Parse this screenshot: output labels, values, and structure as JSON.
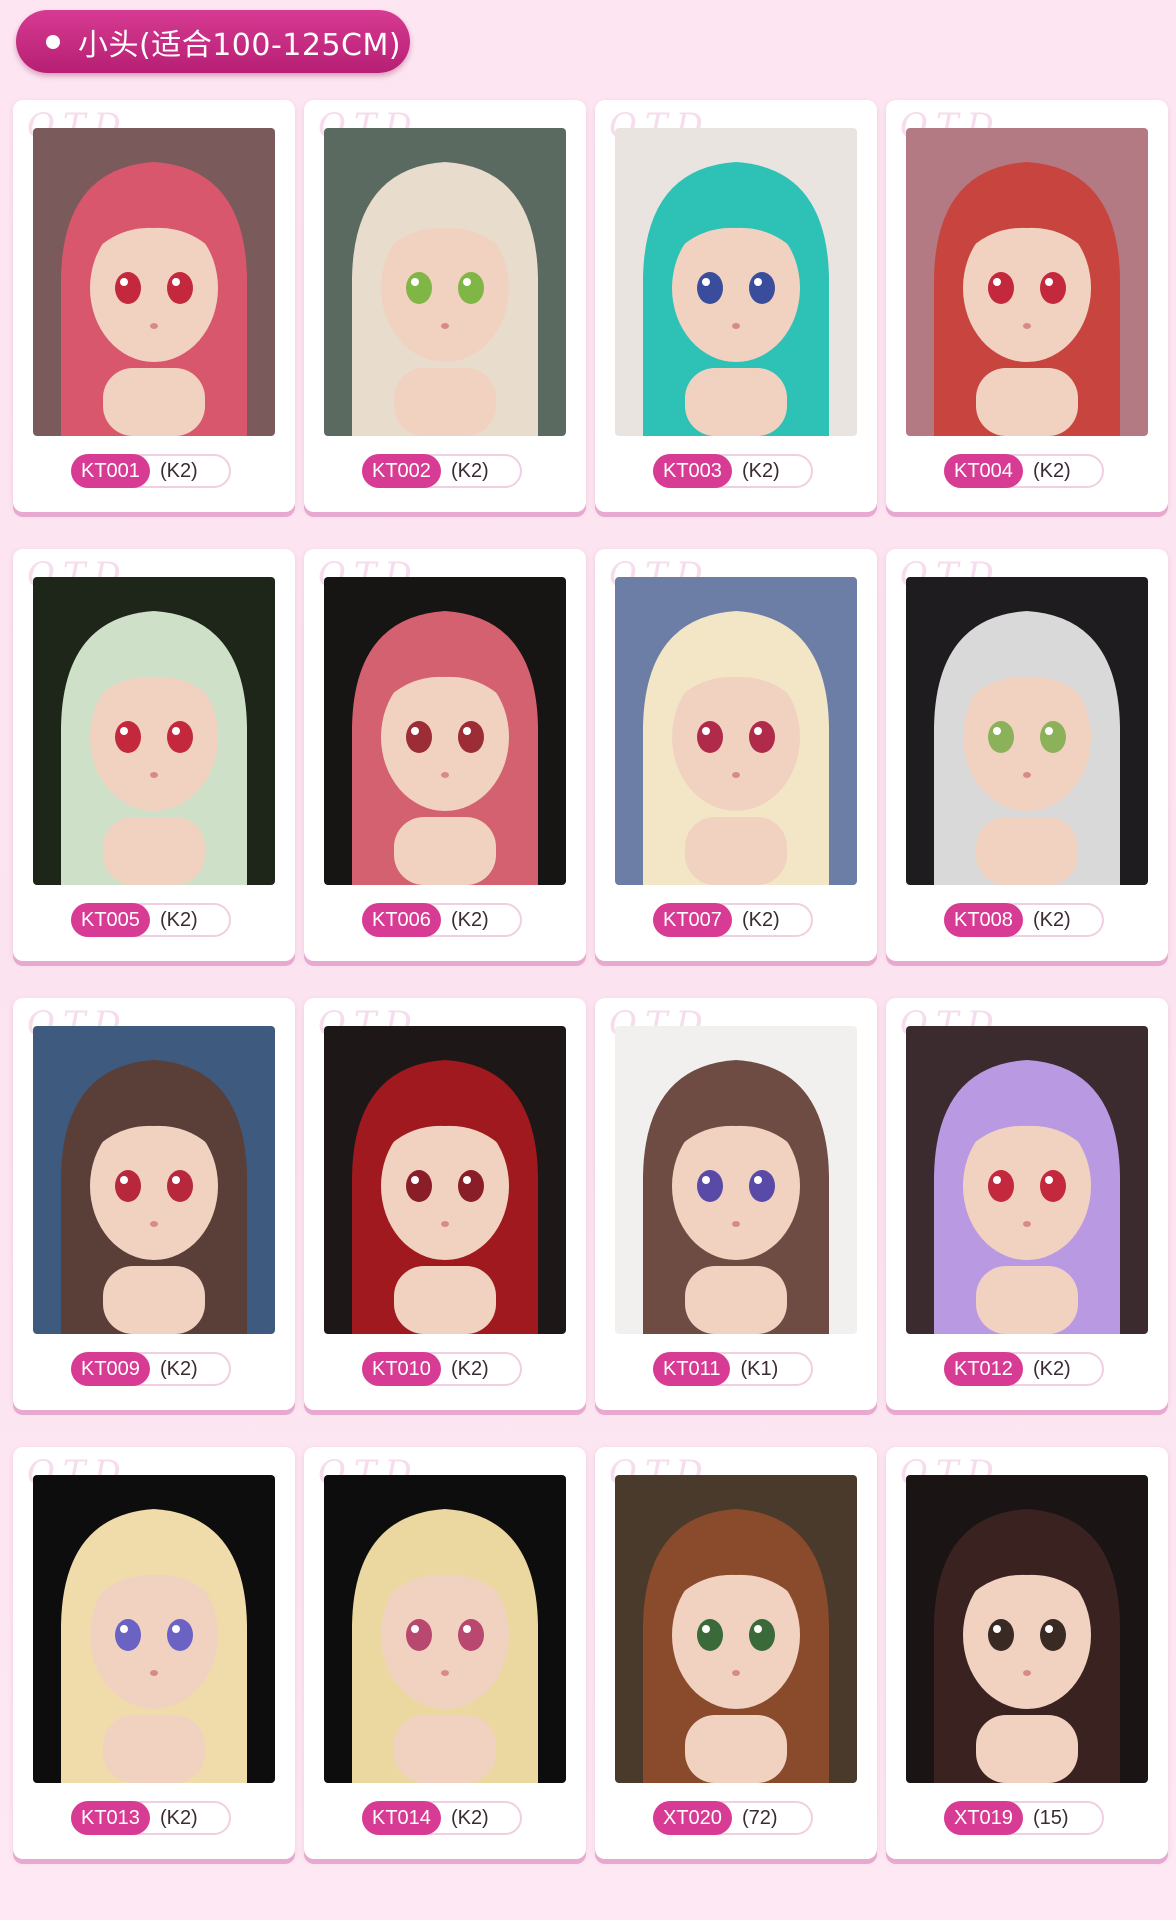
{
  "section": {
    "title": "小头(适合100-125CM)"
  },
  "watermark": "OTD",
  "products": [
    {
      "code": "KT001",
      "tag": "(K2)",
      "hair": "#d9576c",
      "bg": "#7a5a5a",
      "eyes": "#c4283c",
      "icon": "headset-doll-photo"
    },
    {
      "code": "KT002",
      "tag": "(K2)",
      "hair": "#e8dccd",
      "bg": "#5a6a60",
      "eyes": "#7fb646",
      "icon": "elf-doll-photo"
    },
    {
      "code": "KT003",
      "tag": "(K2)",
      "hair": "#2ec1b6",
      "bg": "#e9e4e0",
      "eyes": "#3a4d9c",
      "icon": "teal-doll-photo"
    },
    {
      "code": "KT004",
      "tag": "(K2)",
      "hair": "#c8443f",
      "bg": "#b37a84",
      "eyes": "#c4283c",
      "icon": "police-doll-photo"
    },
    {
      "code": "KT005",
      "tag": "(K2)",
      "hair": "#cfe0c9",
      "bg": "#1d2618",
      "eyes": "#c4283c",
      "icon": "green-doll-photo"
    },
    {
      "code": "KT006",
      "tag": "(K2)",
      "hair": "#d4616f",
      "bg": "#171414",
      "eyes": "#9c2c36",
      "icon": "pink-doll-photo"
    },
    {
      "code": "KT007",
      "tag": "(K2)",
      "hair": "#f2e6c6",
      "bg": "#6d7ea6",
      "eyes": "#b02a4a",
      "icon": "blonde-doll-photo"
    },
    {
      "code": "KT008",
      "tag": "(K2)",
      "hair": "#d9d9d9",
      "bg": "#1e1c1e",
      "eyes": "#8bb25a",
      "icon": "silver-doll-photo"
    },
    {
      "code": "KT009",
      "tag": "(K2)",
      "hair": "#5a3e38",
      "bg": "#3e5a7e",
      "eyes": "#b8283c",
      "icon": "brunette-doll-photo"
    },
    {
      "code": "KT010",
      "tag": "(K2)",
      "hair": "#a0191f",
      "bg": "#1d1717",
      "eyes": "#8a1e28",
      "icon": "red-doll-photo"
    },
    {
      "code": "KT011",
      "tag": "(K1)",
      "hair": "#6e4c44",
      "bg": "#f2f0ee",
      "eyes": "#5a4aa8",
      "icon": "twintail-doll-photo"
    },
    {
      "code": "KT012",
      "tag": "(K2)",
      "hair": "#b99ae2",
      "bg": "#3b2a2e",
      "eyes": "#c4283c",
      "icon": "bunny-doll-photo"
    },
    {
      "code": "KT013",
      "tag": "(K2)",
      "hair": "#efdcaa",
      "bg": "#0e0d0e",
      "eyes": "#6a63c4",
      "icon": "elf-bow-doll-photo"
    },
    {
      "code": "KT014",
      "tag": "(K2)",
      "hair": "#ead8a0",
      "bg": "#0e0d0e",
      "eyes": "#b84870",
      "icon": "elf-blonde-doll-photo"
    },
    {
      "code": "XT020",
      "tag": "(72)",
      "hair": "#8a4a2c",
      "bg": "#4a3a2c",
      "eyes": "#3a6a3a",
      "icon": "foxgirl-doll-photo"
    },
    {
      "code": "XT019",
      "tag": "(15)",
      "hair": "#3a2220",
      "bg": "#1a1414",
      "eyes": "#3a2a24",
      "icon": "flower-doll-photo"
    }
  ]
}
